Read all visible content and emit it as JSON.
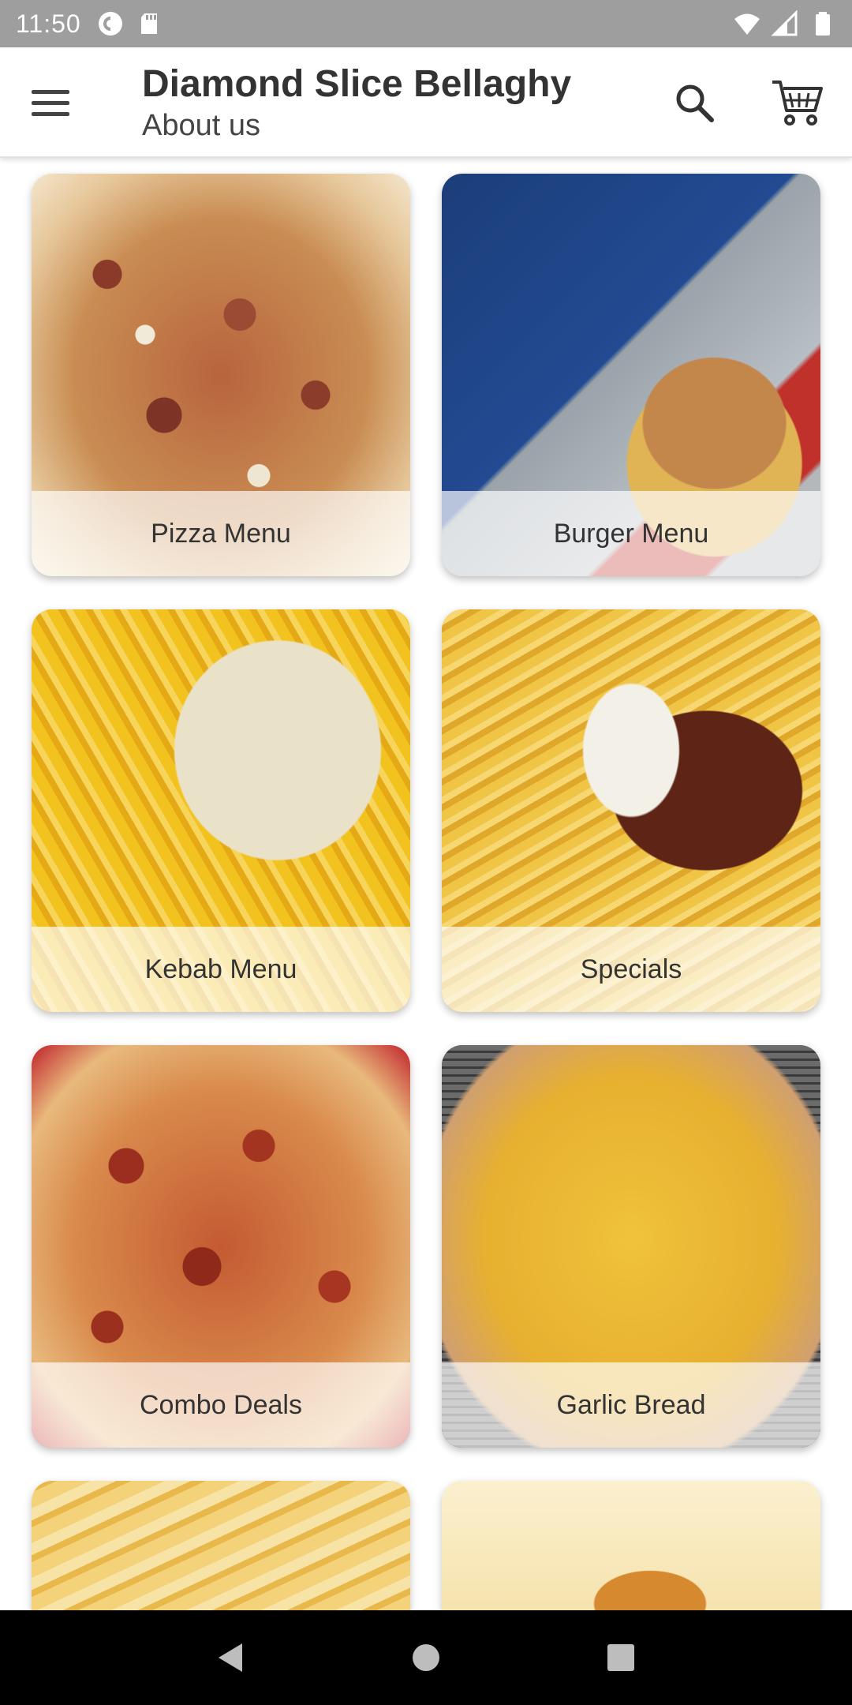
{
  "status_bar": {
    "time": "11:50",
    "left_icons": [
      "pocket-casts-icon",
      "sd-card-icon"
    ],
    "right_icons": [
      "wifi-icon",
      "cell-signal-icon",
      "battery-icon"
    ]
  },
  "app_bar": {
    "title": "Diamond Slice Bellaghy",
    "subtitle": "About us",
    "menu_icon": "hamburger-menu-icon",
    "search_icon": "search-icon",
    "cart_icon": "shopping-cart-icon"
  },
  "categories": [
    {
      "label": "Pizza Menu",
      "image": "pizza-menu-image"
    },
    {
      "label": "Burger Menu",
      "image": "burger-menu-image"
    },
    {
      "label": "Kebab Menu",
      "image": "kebab-menu-image"
    },
    {
      "label": "Specials",
      "image": "specials-image"
    },
    {
      "label": "Combo Deals",
      "image": "combo-deals-image"
    },
    {
      "label": "Garlic Bread",
      "image": "garlic-bread-image"
    },
    {
      "label": "",
      "image": "chips-image"
    },
    {
      "label": "",
      "image": "food-box-image"
    }
  ],
  "nav_bar": {
    "back_icon": "back-triangle-icon",
    "home_icon": "home-circle-icon",
    "recents_icon": "recents-square-icon"
  },
  "colors": {
    "status_bar": "#9e9e9e",
    "app_bar": "#ffffff",
    "label_overlay": "#ffffffad",
    "text": "#333333",
    "nav_bar": "#000000"
  }
}
